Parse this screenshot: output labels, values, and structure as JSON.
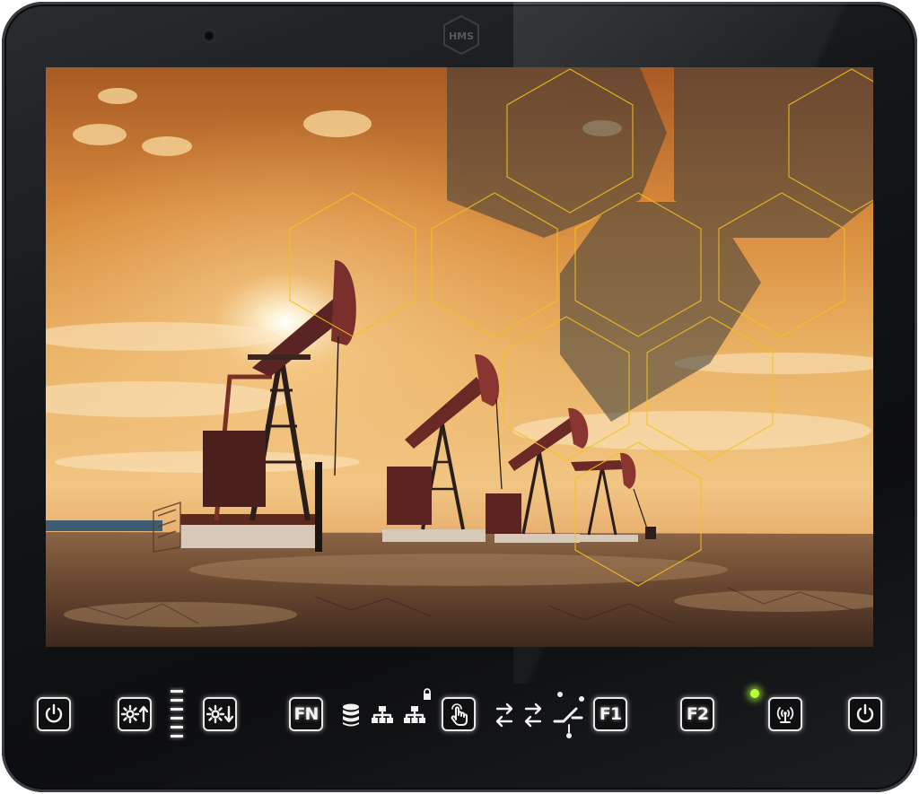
{
  "device": {
    "brand_logo": "HMS"
  },
  "controls": {
    "fn_label": "FN",
    "f1_label": "F1",
    "f2_label": "F2"
  },
  "icons": {
    "power_left": "power-icon",
    "brightness_up": "brightness-up-icon",
    "brightness_down": "brightness-down-icon",
    "database": "database-icon",
    "network": "network-icon",
    "network_locked": "network-lock-icon",
    "touch": "touch-hand-icon",
    "transfer": "transfer-arrows-icon",
    "switch": "switch-icon",
    "wireless": "wireless-icon",
    "power_right": "power-icon"
  },
  "brightness_level": 1.0,
  "colors": {
    "hex_outline": "#f4c21a",
    "led": "#b6ff3a",
    "key_outline": "#e9e9e9"
  }
}
